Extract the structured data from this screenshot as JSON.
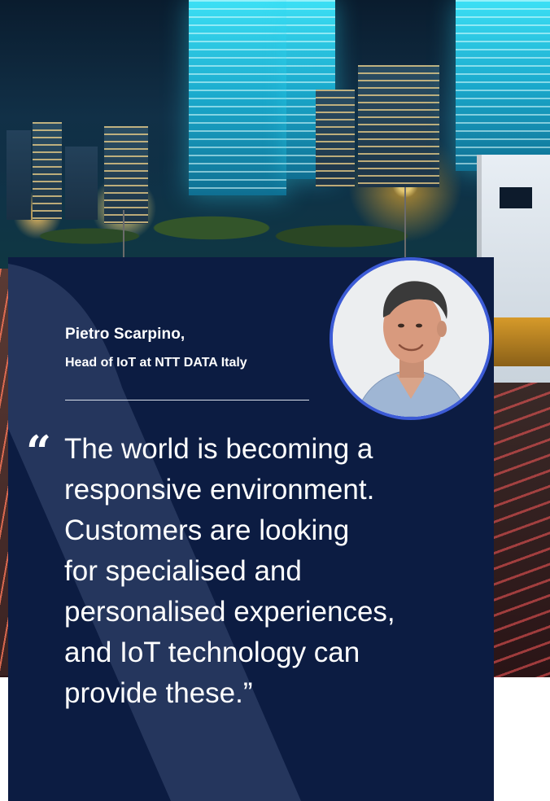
{
  "author": {
    "name": "Pietro Scarpino,",
    "title": "Head of IoT at NTT DATA Italy"
  },
  "quote": {
    "mark_icon": "quote-open-icon",
    "lines": [
      "The world is becoming a",
      "responsive environment.",
      "Customers are looking",
      "for specialised and",
      "personalised experiences,",
      "and IoT technology can",
      "provide these.”"
    ]
  },
  "colors": {
    "panel_background": "#0c1c42",
    "avatar_ring": "#3c5bd6",
    "text": "#ffffff"
  }
}
